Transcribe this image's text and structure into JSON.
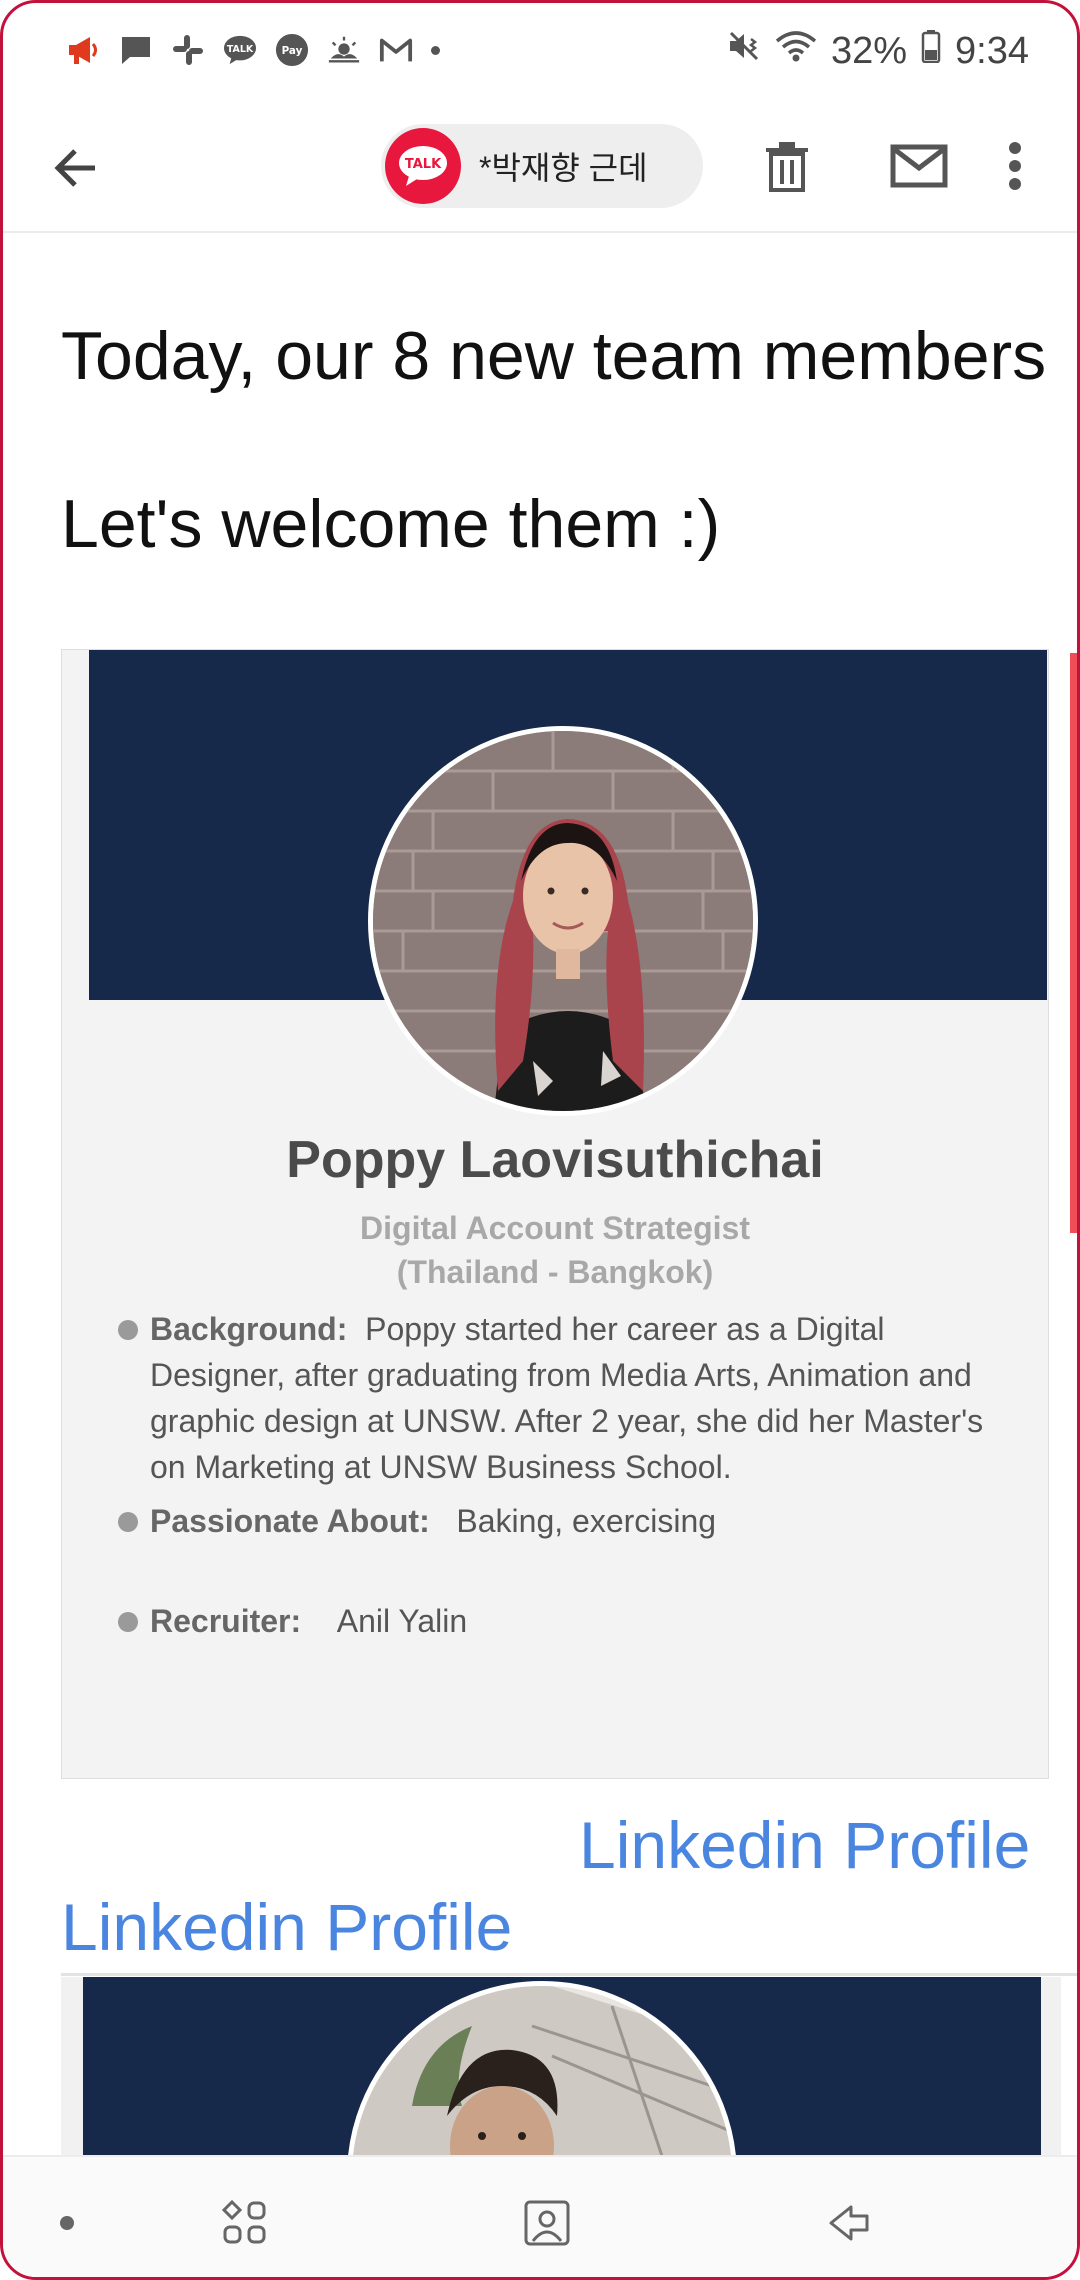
{
  "status_bar": {
    "battery": "32%",
    "time": "9:34",
    "notification_icons": [
      "megaphone-icon",
      "message-icon",
      "slack-icon",
      "kakaotalk-icon",
      "kakaopay-icon",
      "weather-icon",
      "gmail-icon"
    ]
  },
  "toolbar": {
    "chip_icon_text": "TALK",
    "chip_label": "*박재향 근데"
  },
  "email": {
    "headline": "Today, our 8 new team members",
    "welcome": "Let's welcome them :)",
    "member": {
      "name": "Poppy Laovisuthichai",
      "role": "Digital Account Strategist",
      "location": "(Thailand - Bangkok)",
      "background_label": "Background:",
      "background_text": "Poppy started her career as a Digital Designer, after graduating from Media Arts, Animation and graphic design at UNSW. After 2 year, she did her Master's on Marketing at UNSW Business School.",
      "passion_label": "Passionate About:",
      "passion_text": "Baking, exercising",
      "recruiter_label": "Recruiter:",
      "recruiter_text": "Anil Yalin"
    },
    "link_right": "Linkedin Profile",
    "link_left": "Linkedin Profile"
  },
  "colors": {
    "banner": "#17294a",
    "link": "#4a86e0",
    "accent": "#e8173d"
  }
}
